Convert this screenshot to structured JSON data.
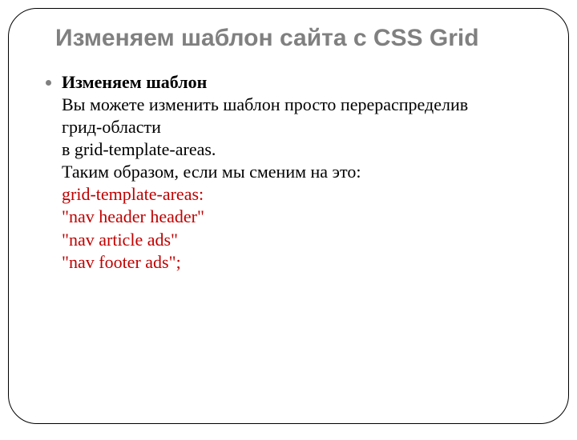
{
  "title": "Изменяем шаблон сайта с CSS Grid",
  "body": {
    "lead": "Изменяем шаблон",
    "p1a": "Вы можете изменить шаблон просто перераспределив грид-области",
    "p1b": "в grid-template-areas.",
    "p2": "Таким образом, если мы сменим на это:",
    "code1": "grid-template-areas:",
    "code2": "\"nav header header\"",
    "code3": "\"nav article ads\"",
    "code4": "\"nav footer ads\";"
  }
}
